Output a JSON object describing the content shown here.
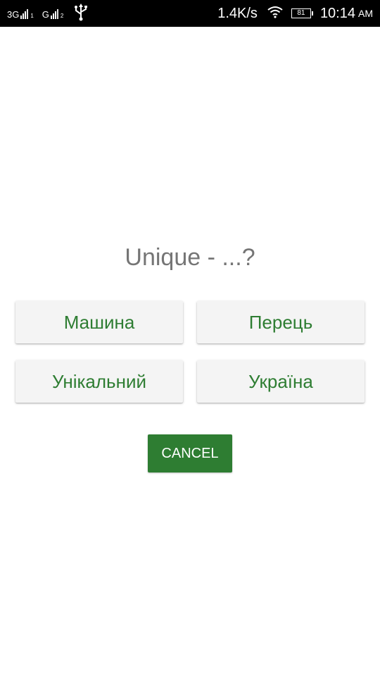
{
  "status_bar": {
    "sim1_label": "3G",
    "sim1_index": "1",
    "sim2_label": "G",
    "sim2_index": "2",
    "usb_icon": "usb-icon",
    "network_speed": "1.4K/s",
    "wifi_icon": "wifi-icon",
    "battery_level": "81",
    "time": "10:14",
    "ampm": "AM"
  },
  "quiz": {
    "question": "Unique - ...?",
    "answers": [
      {
        "label": "Машина"
      },
      {
        "label": "Перець"
      },
      {
        "label": "Унікальний"
      },
      {
        "label": "Україна"
      }
    ],
    "cancel_label": "CANCEL"
  },
  "colors": {
    "accent": "#2e7d32",
    "question_text": "#757575",
    "answer_bg": "#f4f4f4"
  }
}
